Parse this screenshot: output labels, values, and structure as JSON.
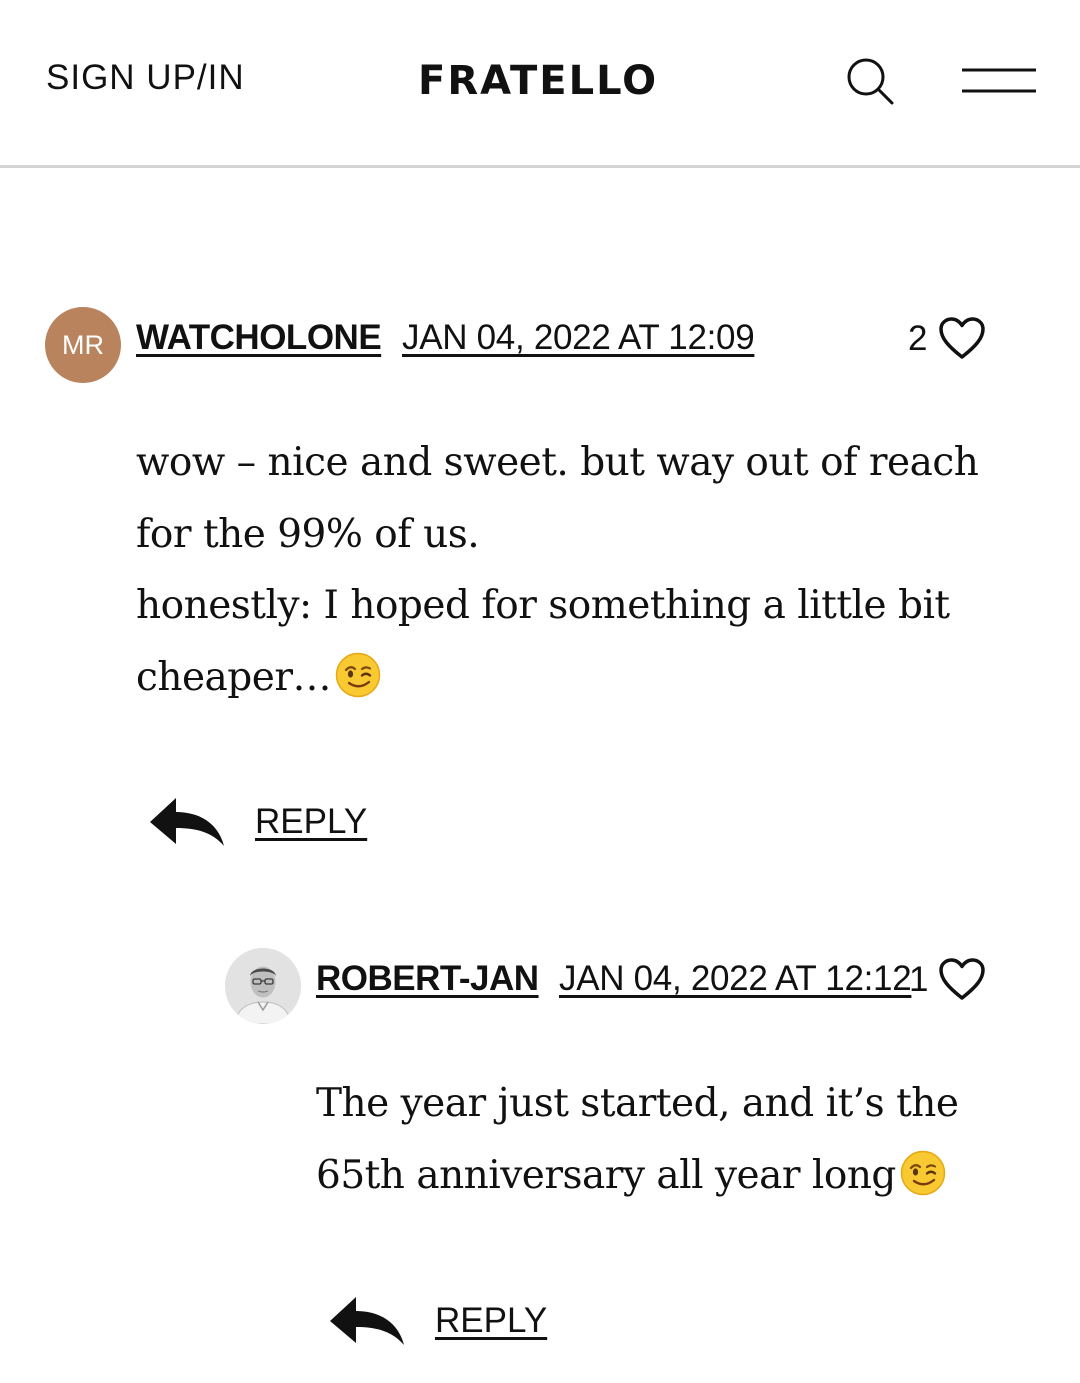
{
  "header": {
    "signin_label": "SIGN UP/IN",
    "logo": "FRATELLO",
    "icons": [
      "search-icon",
      "menu-icon"
    ]
  },
  "comments": [
    {
      "avatar_initials": "MR",
      "avatar_color": "#b9835e",
      "author": "WATCHOLONE",
      "date": "JAN 04, 2022 AT 12:09",
      "likes": "2",
      "lines": [
        "wow – nice and sweet. but way out of reach",
        "for the 99% of us.",
        "honestly: I hoped for something a little bit",
        "cheaper…"
      ],
      "emoji": "winking-face",
      "reply_label": "REPLY"
    },
    {
      "author": "ROBERT-JAN",
      "date": "JAN 04, 2022 AT 12:12",
      "likes": "1",
      "lines": [
        "The year just started, and it’s the",
        "65th anniversary all year long"
      ],
      "emoji": "winking-face",
      "reply_label": "REPLY"
    }
  ]
}
